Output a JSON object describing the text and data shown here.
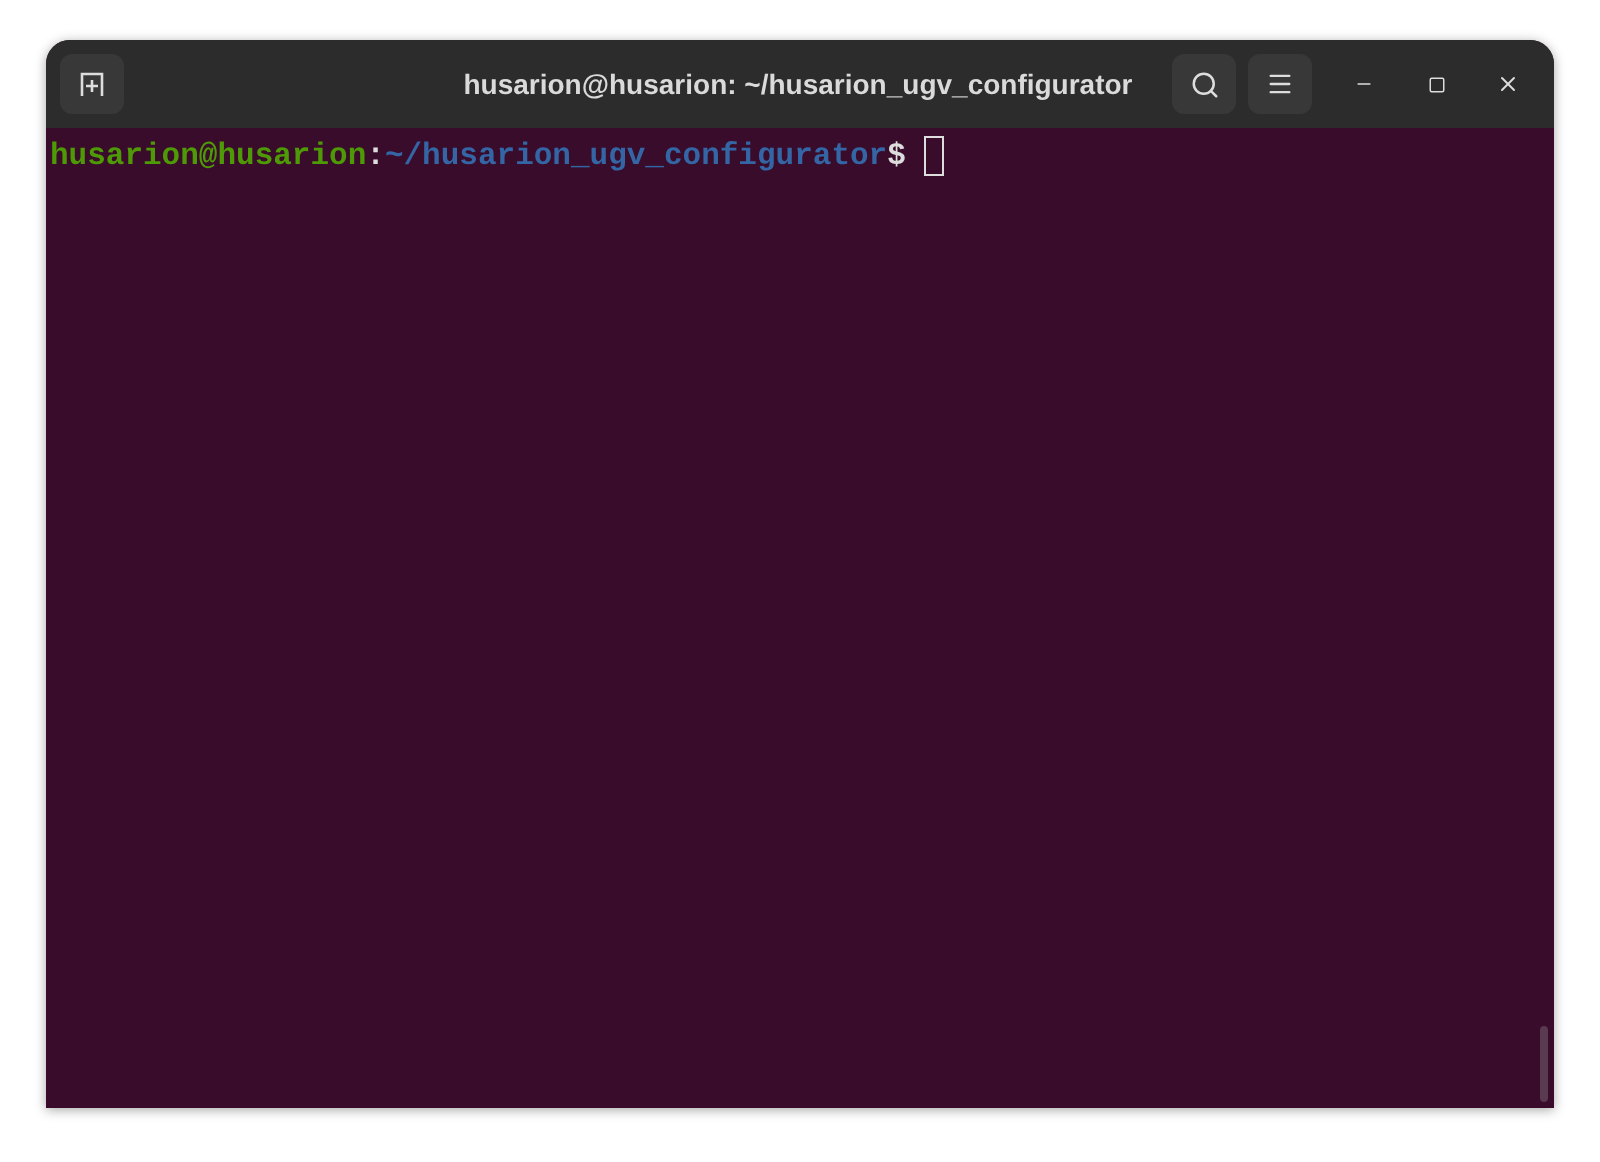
{
  "window": {
    "title": "husarion@husarion: ~/husarion_ugv_configurator"
  },
  "terminal": {
    "prompt": {
      "user_host": "husarion@husarion",
      "separator": ":",
      "path": "~/husarion_ugv_configurator",
      "symbol": "$"
    }
  }
}
